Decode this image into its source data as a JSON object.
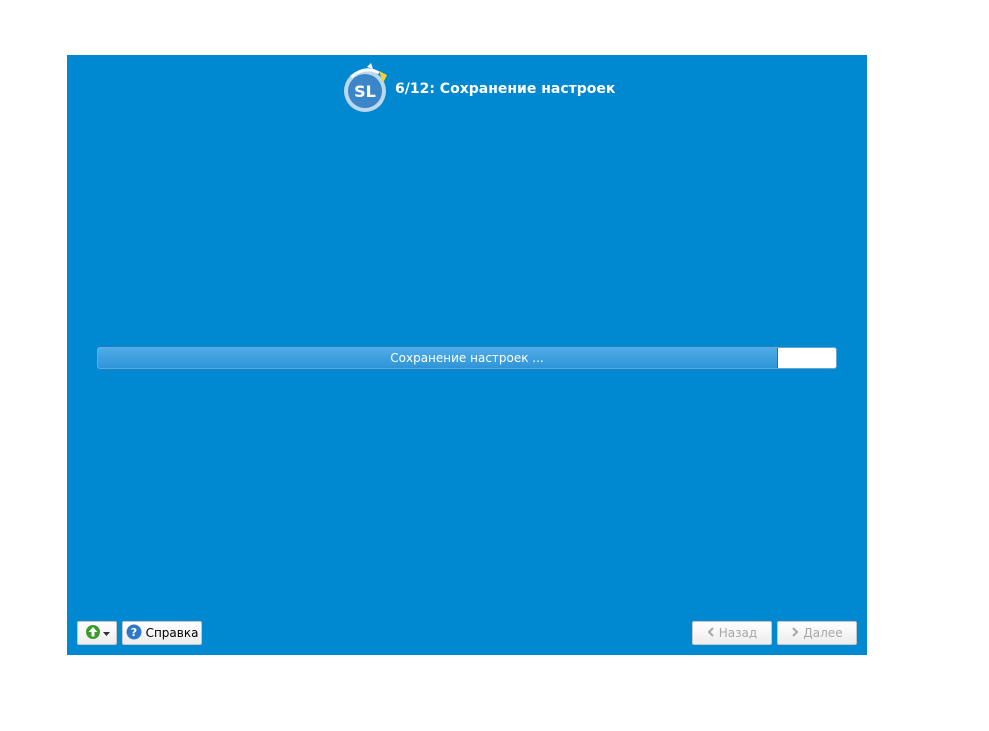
{
  "header": {
    "title": "6/12: Сохранение настроек",
    "logo_text": "SL"
  },
  "progress": {
    "text": "Сохранение настроек ...",
    "percent": 92
  },
  "footer": {
    "menu_button_icon": "green-up-arrow-icon",
    "help_label": "Справка",
    "back_label": "Назад",
    "next_label": "Далее"
  },
  "colors": {
    "background": "#0088d1",
    "progress_fill": "#3d9fe0",
    "disabled_text": "#a7a7a7"
  }
}
